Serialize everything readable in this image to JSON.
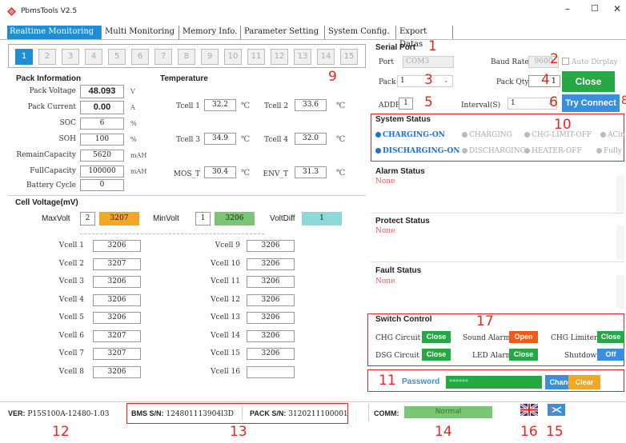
{
  "app": {
    "title": "PbmsTools V2.5",
    "min": "–",
    "max": "☐",
    "close": "✕"
  },
  "tabs": [
    "Realtime Monitoring",
    "Multi Monitoring",
    "Memory Info.",
    "Parameter Setting",
    "System Config.",
    "Export Datas"
  ],
  "cells": [
    "1",
    "2",
    "3",
    "4",
    "5",
    "6",
    "7",
    "8",
    "9",
    "10",
    "11",
    "12",
    "13",
    "14",
    "15"
  ],
  "pack": {
    "title": "Pack Information",
    "voltage_label": "Pack Voltage",
    "voltage": "48.093",
    "voltage_unit": "V",
    "current_label": "Pack Current",
    "current": "0.00",
    "current_unit": "A",
    "soc_label": "SOC",
    "soc": "6",
    "soc_unit": "%",
    "soh_label": "SOH",
    "soh": "100",
    "soh_unit": "%",
    "remain_label": "RemainCapacity",
    "remain": "5620",
    "remain_unit": "mAH",
    "full_label": "FullCapacity",
    "full": "100000",
    "full_unit": "mAH",
    "cycle_label": "Battery Cycle",
    "cycle": "0"
  },
  "temp": {
    "title": "Temperature",
    "t1_label": "Tcell 1",
    "t1": "32.2",
    "t2_label": "Tcell 2",
    "t2": "33.6",
    "t3_label": "Tcell 3",
    "t3": "34.9",
    "t4_label": "Tcell 4",
    "t4": "32.0",
    "mos_label": "MOS_T",
    "mos": "30.4",
    "env_label": "ENV_T",
    "env": "31.3",
    "unit": "℃"
  },
  "cellv": {
    "title": "Cell Voltage(mV)",
    "maxvolt_label": "MaxVolt",
    "maxvolt_idx": "2",
    "maxvolt": "3207",
    "minvolt_label": "MinVolt",
    "minvolt_idx": "1",
    "minvolt": "3206",
    "diff_label": "VoltDiff",
    "diff": "1",
    "left": [
      {
        "label": "Vcell 1",
        "value": "3206"
      },
      {
        "label": "Vcell 2",
        "value": "3207"
      },
      {
        "label": "Vcell 3",
        "value": "3206"
      },
      {
        "label": "Vcell 4",
        "value": "3206"
      },
      {
        "label": "Vcell 5",
        "value": "3206"
      },
      {
        "label": "Vcell 6",
        "value": "3207"
      },
      {
        "label": "Vcell 7",
        "value": "3207"
      },
      {
        "label": "Vcell 8",
        "value": "3206"
      }
    ],
    "right": [
      {
        "label": "Vcell 9",
        "value": "3206"
      },
      {
        "label": "Vcell 10",
        "value": "3206"
      },
      {
        "label": "Vcell 11",
        "value": "3206"
      },
      {
        "label": "Vcell 12",
        "value": "3206"
      },
      {
        "label": "Vcell 13",
        "value": "3206"
      },
      {
        "label": "Vcell 14",
        "value": "3206"
      },
      {
        "label": "Vcell 15",
        "value": "3206"
      },
      {
        "label": "Vcell 16",
        "value": ""
      }
    ]
  },
  "serial": {
    "title": "Serial Port",
    "port_label": "Port",
    "port": "COM3",
    "baud_label": "Baud Rate",
    "baud": "9600",
    "auto_label": "Auto Dirplay",
    "pack_label": "Pack",
    "pack": "1",
    "qty_label": "Pack Qty",
    "qty": "1",
    "close_btn": "Close",
    "addr_label": "ADDR",
    "addr": "1",
    "interval_label": "Interval(S)",
    "interval": "1",
    "try_btn": "Try Connect"
  },
  "system": {
    "title": "System Status",
    "row1": [
      "CHARGING-ON",
      "CHARGING",
      "CHG-LIMIT-OFF",
      "ACin"
    ],
    "row2": [
      "DISCHARGING-ON",
      "DISCHARGING",
      "HEATER-OFF",
      "Fully"
    ]
  },
  "alarm": {
    "title": "Alarm Status",
    "text": "None"
  },
  "protect": {
    "title": "Protect Status",
    "text": "None"
  },
  "fault": {
    "title": "Fault Status",
    "text": "None"
  },
  "switch": {
    "title": "Switch Control",
    "chg_label": "CHG Circuit",
    "chg": "Close",
    "sound_label": "Sound Alarm",
    "sound": "Open",
    "limiter_label": "CHG Limiter",
    "limiter": "Close",
    "dsg_label": "DSG Circuit",
    "dsg": "Close",
    "led_label": "LED Alarm",
    "led": "Close",
    "shutdown_label": "Shutdown",
    "shutdown": "Off"
  },
  "password": {
    "label": "Password",
    "value": "******",
    "change": "Change",
    "clear": "Clear"
  },
  "footer": {
    "ver_label": "VER:",
    "ver": "P15S100A-12480-1.03",
    "bms_label": "BMS S/N:",
    "bms": "124801113904l3D",
    "pack_label": "PACK S/N:",
    "pack": "3120211100001",
    "comm_label": "COMM:",
    "comm": "Normal"
  },
  "markers": {
    "m1": "1",
    "m2": "2",
    "m3": "3",
    "m4": "4",
    "m5": "5",
    "m6": "6",
    "m8": "8",
    "m9": "9",
    "m10": "10",
    "m11": "11",
    "m12": "12",
    "m13": "13",
    "m14": "14",
    "m15": "15",
    "m16": "16",
    "m17": "17"
  },
  "colors": {
    "accent": "#1e8fd6",
    "green": "#27a844",
    "orange": "#f5a623",
    "lightgreen": "#7cc576",
    "cyan": "#8fd8d8",
    "red": "#e22"
  }
}
